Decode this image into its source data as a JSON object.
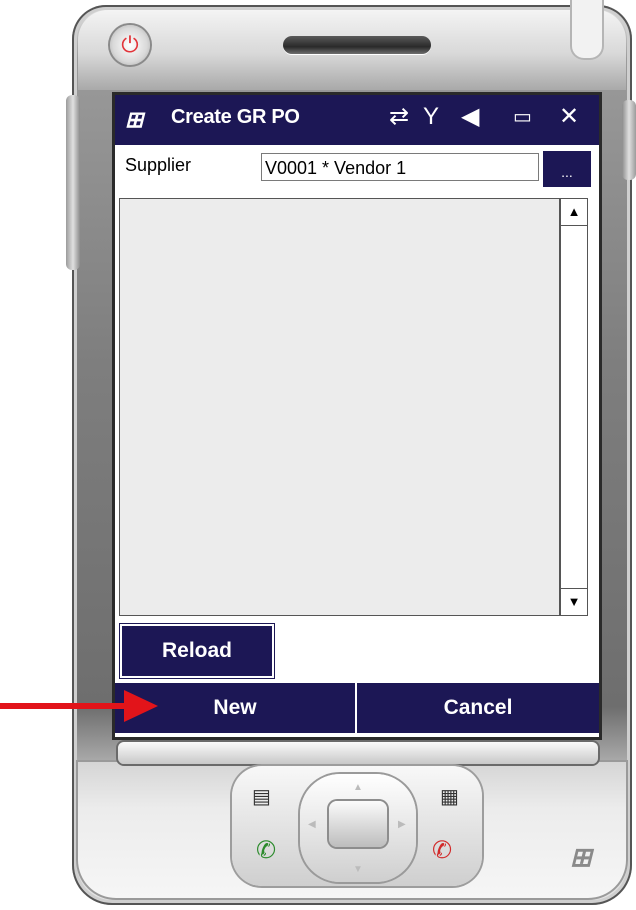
{
  "window": {
    "title": "Create GR PO",
    "status_icons": [
      "sync-icon",
      "no-signal-icon",
      "volume-icon",
      "battery-icon",
      "close-icon"
    ]
  },
  "form": {
    "supplier_label": "Supplier",
    "supplier_value": "V0001 * Vendor 1",
    "browse_label": "..."
  },
  "list": {
    "items": []
  },
  "buttons": {
    "reload": "Reload",
    "new": "New",
    "cancel": "Cancel"
  },
  "colors": {
    "accent": "#1c1755",
    "annotation": "#e2141a"
  }
}
